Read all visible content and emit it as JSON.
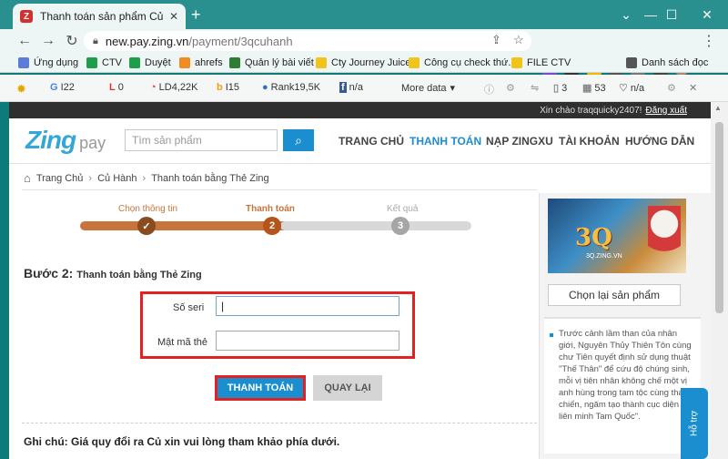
{
  "browser": {
    "tab_title": "Thanh toán sản phẩm Củ Hành -",
    "tab_favicon": "Z",
    "url_host": "new.pay.zing.vn",
    "url_path": "/payment/3qcuhanh",
    "window_controls": {
      "minimize": "—",
      "maximize": "☐",
      "close": "✕"
    }
  },
  "bookmarks": [
    {
      "label": "Ứng dụng",
      "color": "#5b7dd8"
    },
    {
      "label": "CTV",
      "color": "#1e9e4a"
    },
    {
      "label": "Duyệt",
      "color": "#1e9e4a"
    },
    {
      "label": "ahrefs",
      "color": "#f28b22"
    },
    {
      "label": "Quản lý bài viết",
      "color": "#2f7d32"
    },
    {
      "label": "Cty Journey Juice",
      "color": "#f0c419"
    },
    {
      "label": "Công cụ check thứ...",
      "color": "#f0c419"
    },
    {
      "label": "FILE CTV",
      "color": "#f0c419"
    }
  ],
  "reading_list": "Danh sách đọc",
  "seo_bar": {
    "g": "I22",
    "l": "0",
    "ld": "LD4,22K",
    "i": "I15",
    "rank": "Rank19,5K",
    "fb": "n/a",
    "more": "More data",
    "stat1": "3",
    "stat2": "53",
    "stat3": "n/a"
  },
  "site": {
    "greeting": "Xin chào traqquicky2407!",
    "logout": "Đăng xuất",
    "logo_zing": "Zing",
    "logo_pay": "pay",
    "search_placeholder": "Tìm sản phẩm",
    "menu": [
      "TRANG CHỦ",
      "THANH TOÁN",
      "NẠP ZINGXU",
      "TÀI KHOẢN",
      "HƯỚNG DẪN"
    ],
    "breadcrumb": [
      "Trang Chủ",
      "Củ Hành",
      "Thanh toán bằng Thẻ Zing"
    ]
  },
  "steps": [
    {
      "label": "Chọn thông tin",
      "state": "done",
      "mark": "✓"
    },
    {
      "label": "Thanh toán",
      "state": "current",
      "mark": "2"
    },
    {
      "label": "Kết quả",
      "state": "todo",
      "mark": "3"
    }
  ],
  "form": {
    "step_prefix": "Bước 2:",
    "step_title": "Thanh toán bằng Thẻ Zing",
    "serial_label": "Số seri",
    "serial_value": "|",
    "pin_label": "Mật mã thẻ",
    "pin_value": "",
    "pay_button": "THANH TOÁN",
    "back_button": "QUAY LẠI"
  },
  "note": "Ghi chú: Giá quy đổi ra Củ xin vui lòng tham khảo phía dưới.",
  "sidebar": {
    "banner_title": "3Q",
    "banner_sub": "3Q.ZING.VN",
    "reselect": "Chọn lại sản phẩm",
    "description": "Trước cảnh lầm than của nhân giới, Nguyên Thủy Thiên Tôn cùng chư Tiên quyết định sử dụng thuật \"Thế Thân\" để cứu độ chúng sinh, mỗi vị tiên nhân không chế một vị anh hùng trong tam tộc cùng tham chiến, ngăm tạo thành cục diện liên minh Tam Quốc\".",
    "help": "Hỗ trợ"
  }
}
